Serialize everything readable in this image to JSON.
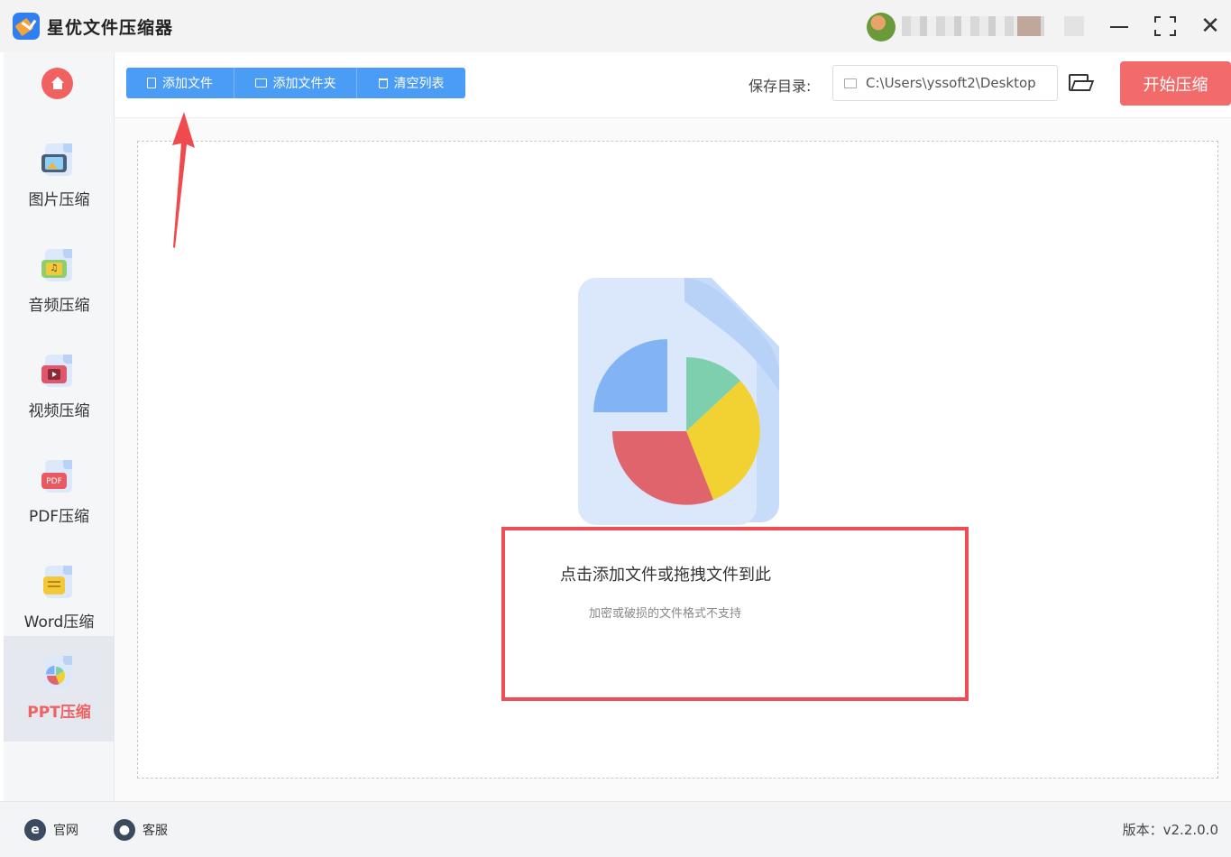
{
  "app": {
    "title": "星优文件压缩器",
    "version_label": "版本：v2.2.0.0"
  },
  "sidebar": {
    "items": [
      {
        "label": "图片压缩",
        "icon": "image-icon",
        "active": false
      },
      {
        "label": "音频压缩",
        "icon": "audio-icon",
        "active": false
      },
      {
        "label": "视频压缩",
        "icon": "video-icon",
        "active": false
      },
      {
        "label": "PDF压缩",
        "icon": "pdf-icon",
        "active": false
      },
      {
        "label": "Word压缩",
        "icon": "word-icon",
        "active": false
      },
      {
        "label": "PPT压缩",
        "icon": "ppt-icon",
        "active": true
      }
    ]
  },
  "toolbar": {
    "add_file": "添加文件",
    "add_folder": "添加文件夹",
    "clear_list": "清空列表",
    "save_dir_label": "保存目录:",
    "save_dir_value": "C:\\Users\\yssoft2\\Desktop",
    "start_button": "开始压缩"
  },
  "dropzone": {
    "title": "点击添加文件或拖拽文件到此",
    "subtitle": "加密或破损的文件格式不支持"
  },
  "footer": {
    "website": "官网",
    "support": "客服"
  },
  "pdf_badge": "PDF",
  "colors": {
    "accent_blue": "#4b9cf5",
    "accent_red": "#f36a6a",
    "highlight_frame": "#ef4d55",
    "annotation_arrow": "#f04a4f"
  }
}
